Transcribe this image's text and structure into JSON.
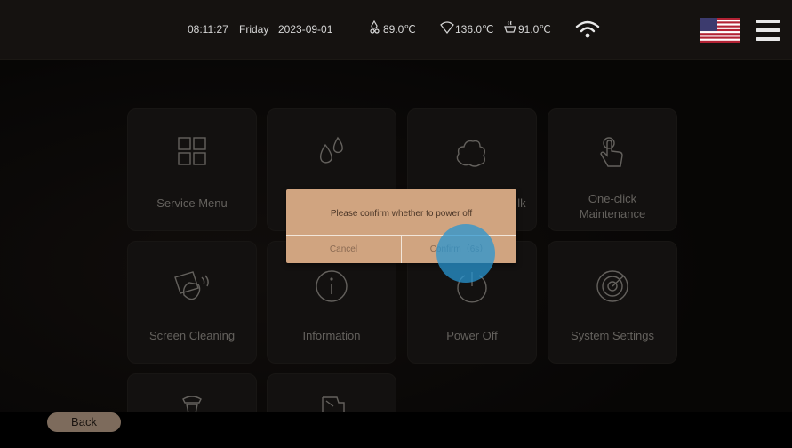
{
  "status_bar": {
    "time": "08:11:27",
    "day": "Friday",
    "date": "2023-09-01",
    "temp1": "89.0℃",
    "temp2": "136.0℃",
    "temp3": "91.0℃",
    "language_flag": "us-flag-icon"
  },
  "tiles": [
    {
      "label": "Service Menu",
      "icon": "grid-icon"
    },
    {
      "label": "",
      "icon": "water-drops-icon"
    },
    {
      "label": "lk",
      "icon": "milk-foam-icon"
    },
    {
      "label": "One-click\nMaintenance",
      "icon": "touch-hand-icon"
    },
    {
      "label": "Screen Cleaning",
      "icon": "cleaning-hand-icon"
    },
    {
      "label": "Information",
      "icon": "info-icon"
    },
    {
      "label": "Power Off",
      "icon": "power-icon"
    },
    {
      "label": "System Settings",
      "icon": "radar-settings-icon"
    }
  ],
  "dialog": {
    "message": "Please confirm whether to power off",
    "cancel": "Cancel",
    "confirm": "Confirm（6s）"
  },
  "bottom": {
    "back": "Back"
  },
  "colors": {
    "dialog_bg": "#d0a480",
    "tile_bg": "#1e1b19",
    "touch": "#2896d2"
  }
}
